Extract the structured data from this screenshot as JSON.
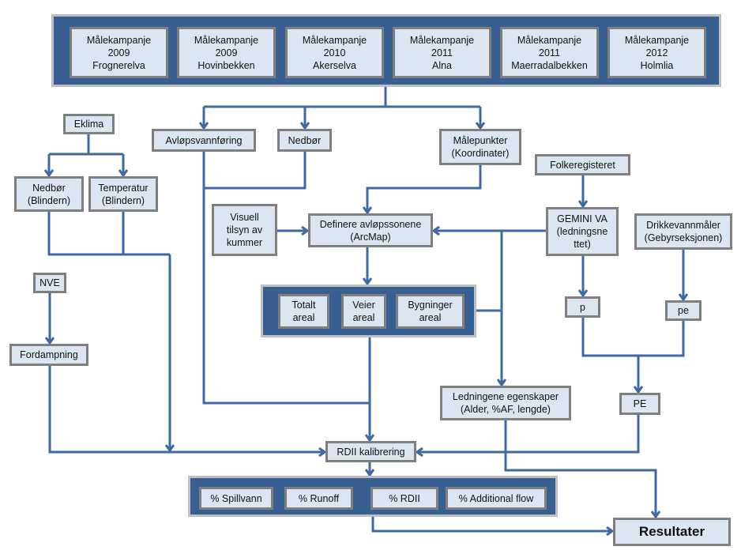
{
  "campaigns": [
    {
      "line1": "Målekampanje",
      "line2": "2009",
      "line3": "Frognerelva"
    },
    {
      "line1": "Målekampanje",
      "line2": "2009",
      "line3": "Hovinbekken"
    },
    {
      "line1": "Målekampanje",
      "line2": "2010",
      "line3": "Akerselva"
    },
    {
      "line1": "Målekampanje",
      "line2": "2011",
      "line3": "Alna"
    },
    {
      "line1": "Målekampanje",
      "line2": "2011",
      "line3": "Maerradalbekken"
    },
    {
      "line1": "Målekampanje",
      "line2": "2012",
      "line3": "Holmlia"
    }
  ],
  "nodes": {
    "eklima": "Eklima",
    "nedbor_blindern": [
      "Nedbør",
      "(Blindern)"
    ],
    "temperatur": [
      "Temperatur",
      "(Blindern)"
    ],
    "nve": "NVE",
    "fordampning": "Fordampning",
    "avlopsvannforing": "Avløpsvannføring",
    "nedbor": "Nedbør",
    "malepunkter": [
      "Målepunkter",
      "(Koordinater)"
    ],
    "visuell": [
      "Visuell",
      "tilsyn av",
      "kummer"
    ],
    "definere": [
      "Definere avløpssonene",
      "(ArcMap)"
    ],
    "folkeregisteret": "Folkeregisteret",
    "gemini": [
      "GEMINI VA",
      "(ledningsne",
      "ttet)"
    ],
    "drikkevann": [
      "Drikkevannmåler",
      "(Gebyrseksjonen)"
    ],
    "p": "p",
    "pe": "pe",
    "PE": "PE",
    "ledningene": [
      "Ledningene egenskaper",
      "(Alder, %AF, lengde)"
    ],
    "rdii_kalibrering": "RDII kalibrering",
    "resultater": "Resultater"
  },
  "areal": [
    [
      "Totalt",
      "areal"
    ],
    [
      "Veier",
      "areal"
    ],
    [
      "Bygninger",
      "areal"
    ]
  ],
  "outputs": [
    "% Spillvann",
    "% Runoff",
    "% RDII",
    "% Additional flow"
  ],
  "colors": {
    "panel": "#375f92",
    "box_fill": "#dce6f2",
    "box_border": "#7f7f7f",
    "connector": "#3d6aa3"
  }
}
